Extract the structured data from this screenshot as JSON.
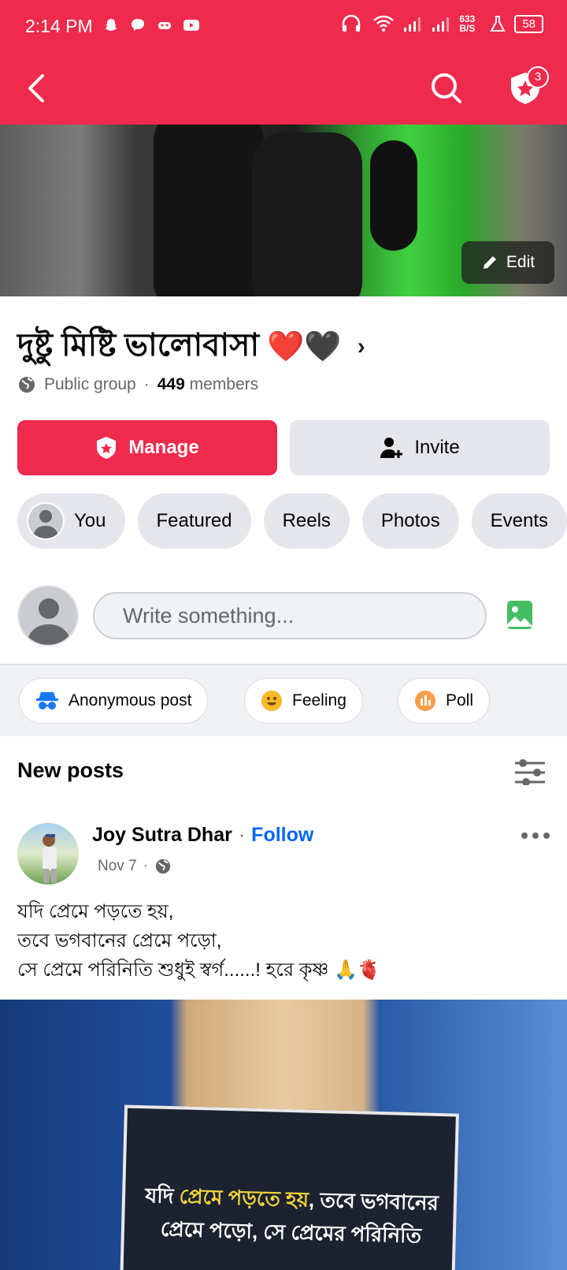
{
  "status_bar": {
    "time": "2:14 PM",
    "net_speed": "633 B/S",
    "battery": "58"
  },
  "top_bar": {
    "notification_count": "3"
  },
  "cover": {
    "edit_label": "Edit"
  },
  "group": {
    "name": "দুষ্টু মিষ্টি ভালোবাসা",
    "name_emoji": "❤️🖤",
    "privacy": "Public group",
    "separator": "·",
    "member_count": "449",
    "members_label": "members"
  },
  "actions": {
    "manage_label": "Manage",
    "invite_label": "Invite"
  },
  "chips": [
    {
      "label": "You"
    },
    {
      "label": "Featured"
    },
    {
      "label": "Reels"
    },
    {
      "label": "Photos"
    },
    {
      "label": "Events"
    }
  ],
  "composer": {
    "placeholder": "Write something..."
  },
  "post_actions": [
    {
      "label": "Anonymous post"
    },
    {
      "label": "Feeling"
    },
    {
      "label": "Poll"
    }
  ],
  "feed": {
    "section_title": "New posts"
  },
  "post": {
    "author": "Joy Sutra Dhar",
    "follow_label": "Follow",
    "date": "Nov 7",
    "text": "যদি প্রেমে পড়তে হয়,\nতবে ভগবানের  প্রেমে পড়ো,\n সে প্রেমে পরিনিতি শুধুই স্বর্গ......! হরে কৃষ্ণ 🙏🫀",
    "image_text_1": "যদি",
    "image_text_2": "প্রেমে পড়তে হয়",
    "image_text_3": ", তবে ভগবানের",
    "image_text_4": "প্রেমে পড়ো, সে প্রেমের পরিনিতি"
  },
  "colors": {
    "brand": "#ee2a4d",
    "link": "#0866ff",
    "chip_bg": "#e4e6eb"
  }
}
